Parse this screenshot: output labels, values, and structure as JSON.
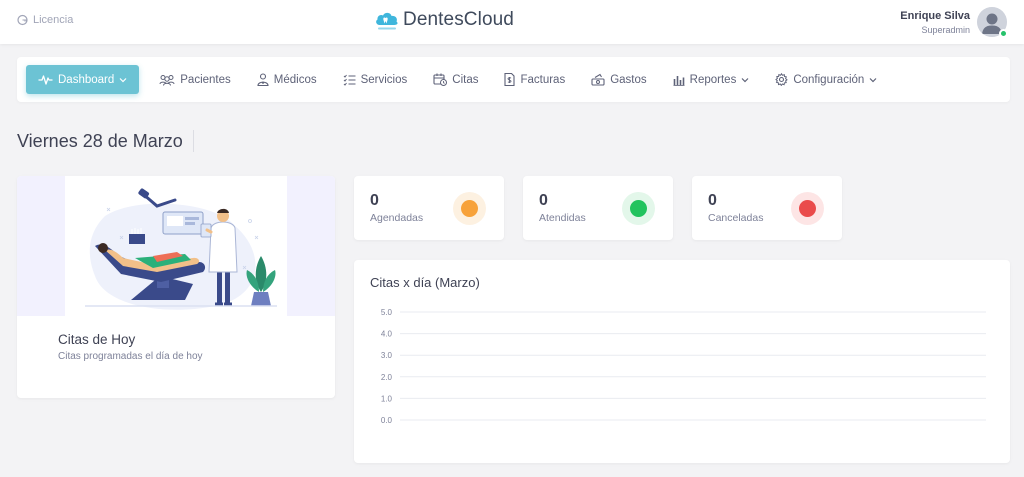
{
  "topbar": {
    "licencia_label": "Licencia",
    "brand": "DentesCloud",
    "user_name": "Enrique Silva",
    "user_role": "Superadmin"
  },
  "nav": {
    "items": [
      {
        "label": "Dashboard",
        "icon": "pulse-icon",
        "active": true,
        "dropdown": true
      },
      {
        "label": "Pacientes",
        "icon": "users-icon"
      },
      {
        "label": "Médicos",
        "icon": "doctor-icon"
      },
      {
        "label": "Servicios",
        "icon": "list-icon"
      },
      {
        "label": "Citas",
        "icon": "calendar-clock-icon"
      },
      {
        "label": "Facturas",
        "icon": "invoice-icon"
      },
      {
        "label": "Gastos",
        "icon": "money-icon"
      },
      {
        "label": "Reportes",
        "icon": "bar-chart-icon",
        "dropdown": true
      },
      {
        "label": "Configuración",
        "icon": "gear-icon",
        "dropdown": true
      }
    ]
  },
  "page": {
    "title": "Viernes 28 de Marzo"
  },
  "hero": {
    "title": "Citas de Hoy",
    "subtitle": "Citas programadas el día de hoy"
  },
  "stats": [
    {
      "value": "0",
      "label": "Agendadas",
      "color": "#f7a23a",
      "bg": "#fdf1e1"
    },
    {
      "value": "0",
      "label": "Atendidas",
      "color": "#22c35e",
      "bg": "#e3f7ea"
    },
    {
      "value": "0",
      "label": "Canceladas",
      "color": "#ea4b4b",
      "bg": "#fde5e5"
    }
  ],
  "chart_data": {
    "type": "line",
    "title": "Citas x día (Marzo)",
    "xlabel": "",
    "ylabel": "",
    "ylim": [
      0,
      5
    ],
    "yticks": [
      "0.0",
      "1.0",
      "2.0",
      "3.0",
      "4.0",
      "5.0"
    ],
    "grid": true,
    "series": []
  },
  "colors": {
    "accent": "#6cc3d4",
    "text": "#3f4254",
    "muted": "#7e8299"
  }
}
